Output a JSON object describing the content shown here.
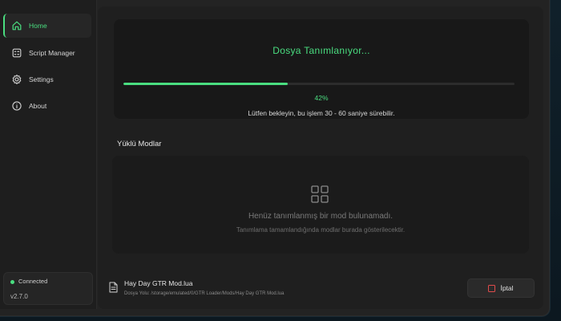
{
  "sidebar": {
    "items": [
      {
        "label": "Home",
        "icon": "home-icon",
        "active": true
      },
      {
        "label": "Script Manager",
        "icon": "script-manager-icon",
        "active": false
      },
      {
        "label": "Settings",
        "icon": "gear-icon",
        "active": false
      },
      {
        "label": "About",
        "icon": "info-icon",
        "active": false
      }
    ],
    "status": {
      "label": "Connected",
      "color": "#4ade80"
    },
    "version": "v2.7.0"
  },
  "progress": {
    "title": "Dosya Tanımlanıyor...",
    "percent_label": "42%",
    "fraction": 0.42,
    "message": "Lütfen bekleyin, bu işlem 30 - 60 saniye sürebilir."
  },
  "mods": {
    "section_title": "Yüklü Modlar",
    "empty_icon": "grid-icon",
    "empty_title": "Henüz tanımlanmış bir mod bulunamadı.",
    "empty_subtitle": "Tanımlama tamamlandığında modlar burada gösterilecektir."
  },
  "file": {
    "icon": "file-icon",
    "name": "Hay Day GTR Mod.lua",
    "path": "Dosya Yolu: /storage/emulated/0/GTR Loader/Mods/Hay Day GTR Mod.lua"
  },
  "cancel_button": {
    "label": "İptal",
    "icon": "stop-icon",
    "color": "#e04b4b"
  },
  "colors": {
    "accent": "#4ade80",
    "background": "#232323"
  }
}
